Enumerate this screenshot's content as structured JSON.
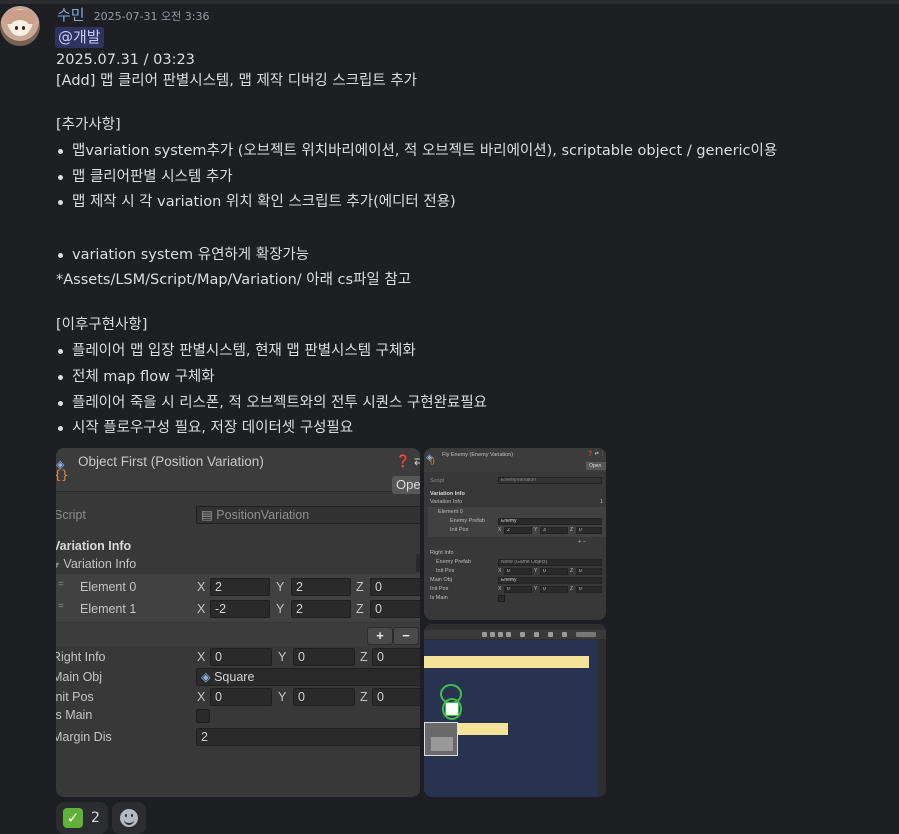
{
  "message": {
    "username": "수민",
    "timestamp": "2025-07-31 오전 3:36",
    "mention": "@개발",
    "date_line": "2025.07.31 / 03:23",
    "title_line": "[Add] 맵 클리어 판별시스템, 맵 제작 디버깅 스크립트 추가",
    "section1_header": "[추가사항]",
    "section1_items": [
      "맵variation system추가 (오브젝트 위치바리에이션, 적 오브젝트 바리에이션), scriptable object / generic이용",
      "맵 클리어판별 시스템 추가",
      "맵 제작 시 각 variation 위치 확인 스크립트 추가(에디터 전용)"
    ],
    "extra_item": "variation system 유연하게 확장가능",
    "path_note": "*Assets/LSM/Script/Map/Variation/ 아래 cs파일 참고",
    "section2_header": "[이후구현사항]",
    "section2_items": [
      "플레이어 맵 입장 판별시스템, 현재 맵 판별시스템 구체화",
      "전체 map flow 구체화",
      "플레이어 죽을 시 리스폰, 적 오브젝트와의 전투 시퀀스 구현완료필요",
      "시작 플로우구성 필요, 저장 데이터셋 구성필요"
    ]
  },
  "inspector_large": {
    "title": "Object First (Position Variation)",
    "header_icons": "❓ ⇄",
    "open_button": "Ope",
    "script_label": "Script",
    "script_value": "PositionVariation",
    "variation_info": "Variation Info",
    "variation_info_sub": "Variation Info",
    "elements": [
      {
        "label": "Element 0",
        "x": "2",
        "y": "2",
        "z": "0"
      },
      {
        "label": "Element 1",
        "x": "-2",
        "y": "2",
        "z": "0"
      }
    ],
    "plus": "+",
    "minus": "−",
    "right_info": {
      "label": "Right Info",
      "x": "0",
      "y": "0",
      "z": "0"
    },
    "main_obj": {
      "label": "Main Obj",
      "value": "Square"
    },
    "init_pos": {
      "label": "Init Pos",
      "x": "0",
      "y": "0",
      "z": "0"
    },
    "is_main": "Is Main",
    "margin_dis": {
      "label": "Margin Dis",
      "value": "2"
    },
    "axis": {
      "x": "X",
      "y": "Y",
      "z": "Z"
    }
  },
  "inspector_small": {
    "title": "Fly Enemy (Enemy Variation)",
    "open_button": "Open",
    "script_label": "Script",
    "script_value": "EnemyVariation",
    "variation_info": "Variation Info",
    "variation_info_sub": "Variation Info",
    "count": "1",
    "element0": "Element 0",
    "enemy_prefab": {
      "label": "Enemy Prefab",
      "value": "Enemy"
    },
    "init_pos_a": {
      "label": "Init Pos",
      "x": "2",
      "y": "3",
      "z": "0"
    },
    "right_info": "Right Info",
    "enemy_prefab_b": {
      "label": "Enemy Prefab",
      "value": "None (Game Object)"
    },
    "init_pos_b": {
      "label": "Init Pos",
      "x": "0",
      "y": "0",
      "z": "0"
    },
    "main_obj": {
      "label": "Main Obj",
      "value": "Enemy"
    },
    "init_pos_c": {
      "label": "Init Pos",
      "x": "0",
      "y": "0",
      "z": "0"
    },
    "is_main": "Is Main",
    "pm": "+ −",
    "axis": {
      "x": "X",
      "y": "Y",
      "z": "Z"
    }
  },
  "reactions": [
    {
      "emoji": "✓",
      "count": "2"
    }
  ],
  "colors": {
    "background": "#1e1f22",
    "username": "#7fa8e4",
    "mention_bg": "#5865f2",
    "inspector_bg": "#383838",
    "scene_bg": "#28344f",
    "yellow_platform": "#f6e39a",
    "gizmo_green": "#3fbf4a",
    "reaction_green": "#5fb137"
  }
}
